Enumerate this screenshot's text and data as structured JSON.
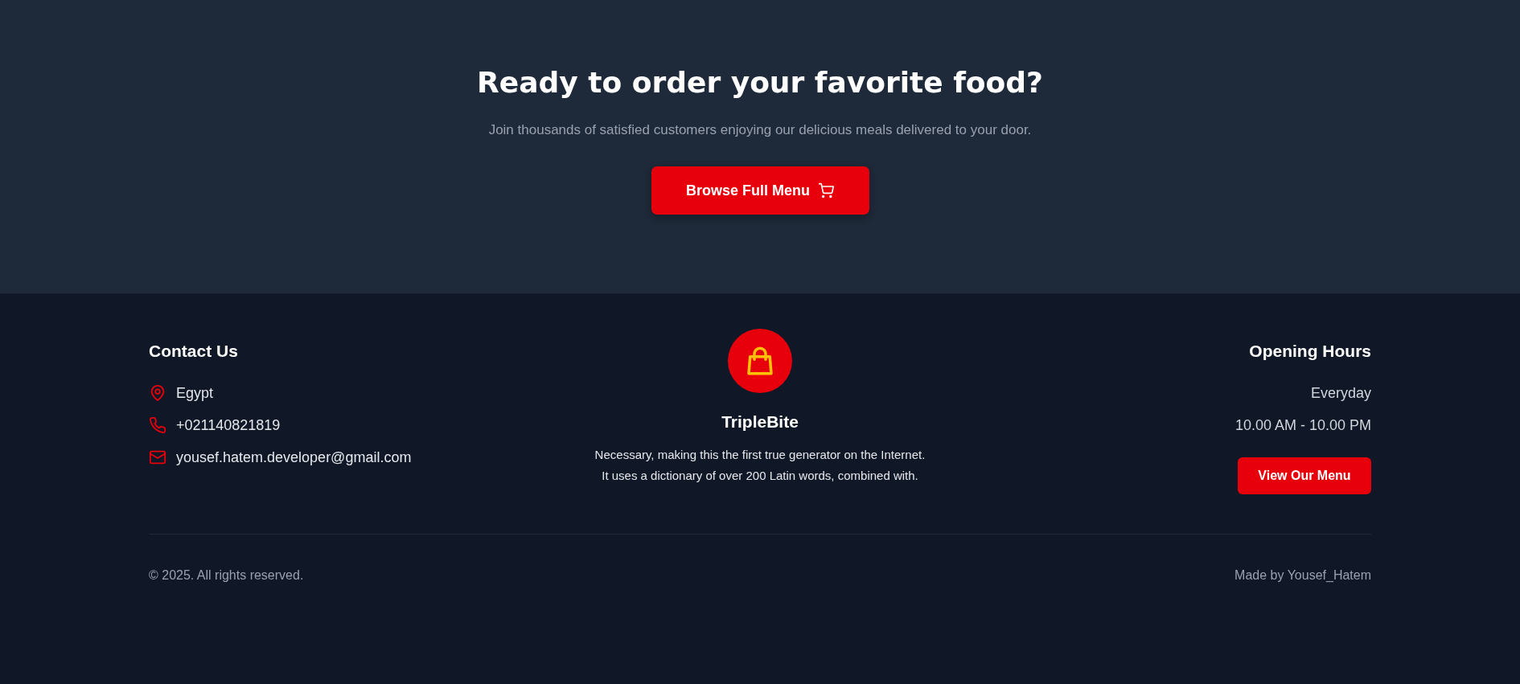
{
  "cta": {
    "title": "Ready to order your favorite food?",
    "subtitle": "Join thousands of satisfied customers enjoying our delicious meals delivered to your door.",
    "button": "Browse Full Menu"
  },
  "contact": {
    "heading": "Contact Us",
    "items": [
      {
        "kind": "location",
        "text": "Egypt"
      },
      {
        "kind": "phone",
        "text": "+021140821819"
      },
      {
        "kind": "email",
        "text": "yousef.hatem.developer@gmail.com"
      }
    ]
  },
  "brand": {
    "name": "TripleBite",
    "lines": [
      "Necessary, making this the first true generator on the Internet.",
      "It uses a dictionary of over 200 Latin words, combined with."
    ]
  },
  "hours": {
    "heading": "Opening Hours",
    "days": "Everyday",
    "time": "10.00 AM - 10.00 PM",
    "button": "View Our Menu"
  },
  "bottom": {
    "copyright": "© 2025. All rights reserved.",
    "credit": "Made by Yousef_Hatem"
  }
}
